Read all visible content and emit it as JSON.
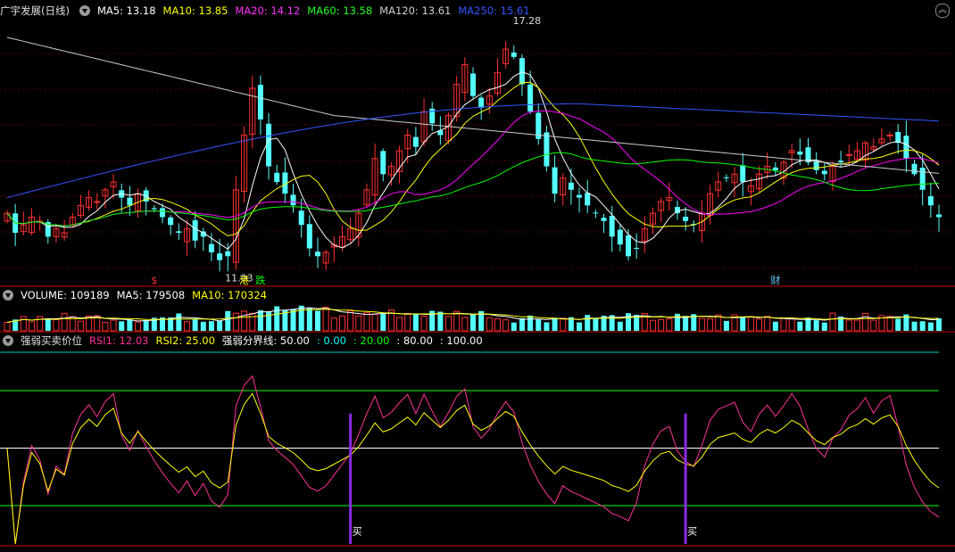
{
  "main_header": {
    "title": "广宇发展(日线)",
    "ma": [
      {
        "label": "MA5: 13.18",
        "color": "#ffffff"
      },
      {
        "label": "MA10: 13.85",
        "color": "#ffff00"
      },
      {
        "label": "MA20: 14.12",
        "color": "#ff00ff"
      },
      {
        "label": "MA60: 13.58",
        "color": "#00ff00"
      },
      {
        "label": "MA120: 13.61",
        "color": "#cccccc"
      },
      {
        "label": "MA250: 15.61",
        "color": "#3355ff"
      }
    ]
  },
  "volume_header": {
    "items": [
      {
        "label": "VOLUME: 109189",
        "color": "#ffffff"
      },
      {
        "label": "MA5: 179508",
        "color": "#ffffff"
      },
      {
        "label": "MA10: 170324",
        "color": "#ffff00"
      }
    ]
  },
  "rsi_header": {
    "title": "强弱买卖价位",
    "items": [
      {
        "label": "RSI1: 12.03",
        "color": "#ff3399"
      },
      {
        "label": "RSI2: 25.00",
        "color": "#ffff00"
      },
      {
        "label": "强弱分界线: 50.00",
        "color": "#ffffff"
      },
      {
        "label": ": 0.00",
        "color": "#00ffff"
      },
      {
        "label": ": 20.00",
        "color": "#00ff00"
      },
      {
        "label": ": 80.00",
        "color": "#ffffff"
      },
      {
        "label": ": 100.00",
        "color": "#ffffff"
      }
    ]
  },
  "annotations": {
    "high_label": "17.28",
    "low_label": "11.03",
    "markers": [
      {
        "text": "$",
        "color": "#ff3333",
        "idx": 18
      },
      {
        "text": "港",
        "color": "#ffff00",
        "idx": 29
      },
      {
        "text": "跌",
        "color": "#00ff00",
        "idx": 31
      },
      {
        "text": "财",
        "color": "#66ccff",
        "idx": 94
      }
    ],
    "buy_label": "买",
    "buy_idx": [
      42,
      83
    ]
  },
  "chart_data": [
    {
      "type": "candlestick",
      "title": "广宇发展(日线)",
      "ylim": [
        10.8,
        17.6
      ],
      "series": [
        {
          "name": "MA5",
          "color": "#ffffff"
        },
        {
          "name": "MA10",
          "color": "#ffff00"
        },
        {
          "name": "MA20",
          "color": "#ff00ff"
        },
        {
          "name": "MA60",
          "color": "#00ff00"
        },
        {
          "name": "MA120",
          "color": "#cccccc"
        },
        {
          "name": "MA250",
          "color": "#3355ff"
        }
      ],
      "closes": [
        12.6,
        12.1,
        12.3,
        12.5,
        12.4,
        12.0,
        12.2,
        12.1,
        12.5,
        12.8,
        13.0,
        12.9,
        13.2,
        13.4,
        13.0,
        12.8,
        13.1,
        12.9,
        12.7,
        12.5,
        12.3,
        12.1,
        12.2,
        11.9,
        12.0,
        11.6,
        11.4,
        11.5,
        13.2,
        14.6,
        15.8,
        15.0,
        13.8,
        13.4,
        13.1,
        12.8,
        12.3,
        11.7,
        11.5,
        11.6,
        11.8,
        12.0,
        12.2,
        12.6,
        13.2,
        14.0,
        13.6,
        13.8,
        14.2,
        14.6,
        14.3,
        15.2,
        14.9,
        14.6,
        15.1,
        15.9,
        16.4,
        15.6,
        15.3,
        15.6,
        16.2,
        16.8,
        16.6,
        15.9,
        15.2,
        14.5,
        13.8,
        13.1,
        13.5,
        13.2,
        13.0,
        12.8,
        12.6,
        12.4,
        12.0,
        11.8,
        11.5,
        11.7,
        12.2,
        12.6,
        12.9,
        13.0,
        12.6,
        12.4,
        12.3,
        12.6,
        13.1,
        13.4,
        13.5,
        13.6,
        13.4,
        13.3,
        13.6,
        13.8,
        13.7,
        13.9,
        14.2,
        14.1,
        13.9,
        13.7,
        13.6,
        13.8,
        13.9,
        14.1,
        14.2,
        14.4,
        14.3,
        14.5,
        14.6,
        14.4,
        14.0,
        13.6,
        13.2,
        12.8,
        12.5
      ],
      "volume_max": 240000,
      "volume_last": 109189,
      "rsi_ylim": [
        0,
        100
      ]
    }
  ]
}
